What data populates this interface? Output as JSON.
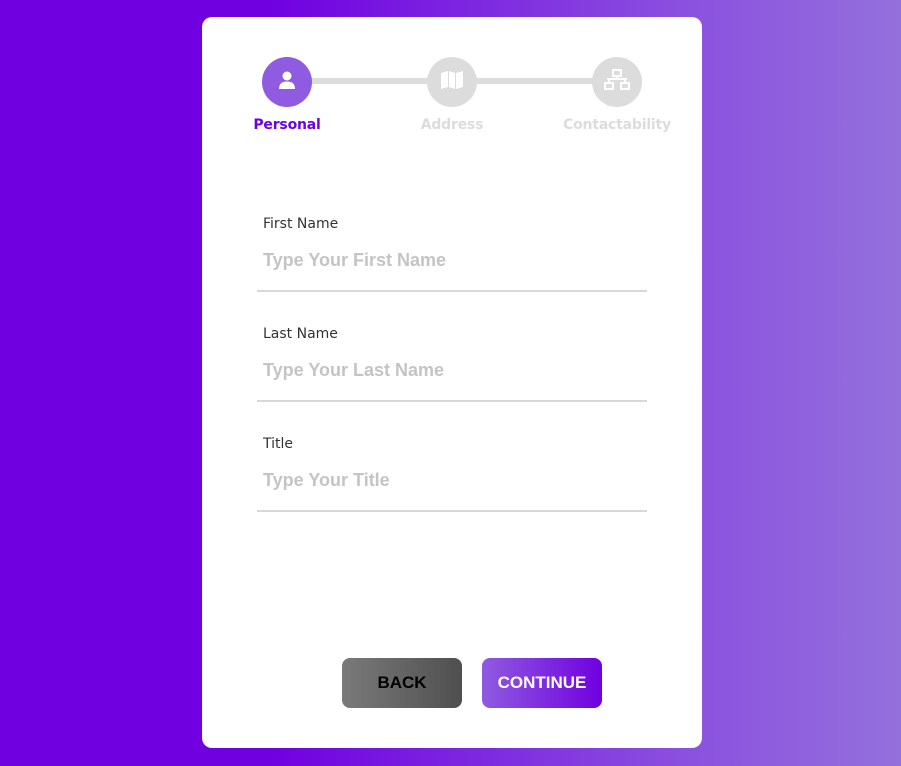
{
  "stepper": {
    "steps": [
      {
        "label": "Personal",
        "icon": "user-icon",
        "active": true
      },
      {
        "label": "Address",
        "icon": "map-icon",
        "active": false
      },
      {
        "label": "Contactability",
        "icon": "sitemap-icon",
        "active": false
      }
    ]
  },
  "form": {
    "first_name": {
      "label": "First Name",
      "placeholder": "Type Your First Name"
    },
    "last_name": {
      "label": "Last Name",
      "placeholder": "Type Your Last Name"
    },
    "title": {
      "label": "Title",
      "placeholder": "Type Your Title"
    }
  },
  "buttons": {
    "back": "BACK",
    "continue": "CONTINUE"
  },
  "colors": {
    "accent": "#7000e0",
    "accent_light": "#8f5be0",
    "inactive": "#dcdcdc"
  }
}
